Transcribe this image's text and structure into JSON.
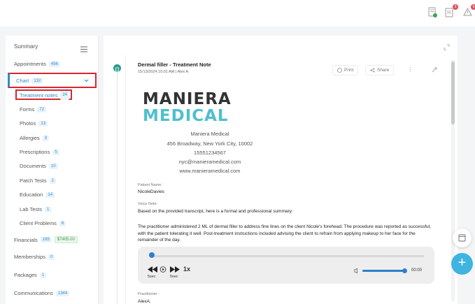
{
  "header": {
    "icons": [
      {
        "name": "document-check-icon",
        "badge_color": "#3ba55c"
      },
      {
        "name": "clipboard-icon",
        "badge": "3",
        "badge_color": "#e0505a"
      },
      {
        "name": "alert-triangle-icon",
        "badge": "6",
        "badge_color": "#e0505a"
      }
    ]
  },
  "sidebar": {
    "summary_label": "Summary",
    "items": [
      {
        "label": "Appointments",
        "count": "456"
      },
      {
        "label": "Chart",
        "count": "132"
      },
      {
        "label": "Treatment notes",
        "count": "24"
      },
      {
        "label": "Forms",
        "count": "72"
      },
      {
        "label": "Photos",
        "count": "13"
      },
      {
        "label": "Allergies",
        "count": "3"
      },
      {
        "label": "Prescriptions",
        "count": "5"
      },
      {
        "label": "Documents",
        "count": "10"
      },
      {
        "label": "Patch Tests",
        "count": "2"
      },
      {
        "label": "Education",
        "count": "14"
      },
      {
        "label": "Lab Tests",
        "count": "1"
      },
      {
        "label": "Client Problems",
        "count": "6"
      },
      {
        "label": "Financials",
        "count": "165",
        "amount": "$7405.00"
      },
      {
        "label": "Memberships",
        "count": "0"
      },
      {
        "label": "Packages",
        "count": "1"
      },
      {
        "label": "Communications",
        "count": "1344"
      }
    ]
  },
  "note": {
    "title": "Dermal filler - Treatment Note",
    "meta": "15/13/2024 10:01 AM | Alex A.",
    "print_label": "Print",
    "share_label": "Share",
    "logo_top": "MANIERA",
    "logo_bottom": "MEDICAL",
    "address_lines": [
      "Maniera Medical",
      "456 Broadway, New York City, 10002",
      "15551234567",
      "nyc@manieramedical.com",
      "www.manieramedical.com"
    ],
    "patient_label": "Patient Name:",
    "patient_value": "NicoleDavies",
    "voice_label": "Voice Note:",
    "voice_intro": "Based on the provided transcript, here is a formal and professional summary:",
    "voice_body": "The practitioner administered 2 ML of dermal filler to address fine lines on the client Nicole's forehead. The procedure was reported as successful, with the patient tolerating it well. Post-treatment instructions included advising the client to refrain from applying makeup to her face for the remainder of the day.",
    "practitioner_label": "Practitioner :",
    "practitioner_value": "AlexA."
  },
  "player": {
    "rewind_label": "5sec",
    "forward_label": "5sec",
    "speed": "1x",
    "time": "00:00",
    "progress": 0,
    "volume": 1.0
  },
  "colors": {
    "accent": "#2e8bc9",
    "highlight_border": "#d8262f",
    "logo_teal": "#4fc0ce",
    "fab": "#3fb4e0"
  }
}
